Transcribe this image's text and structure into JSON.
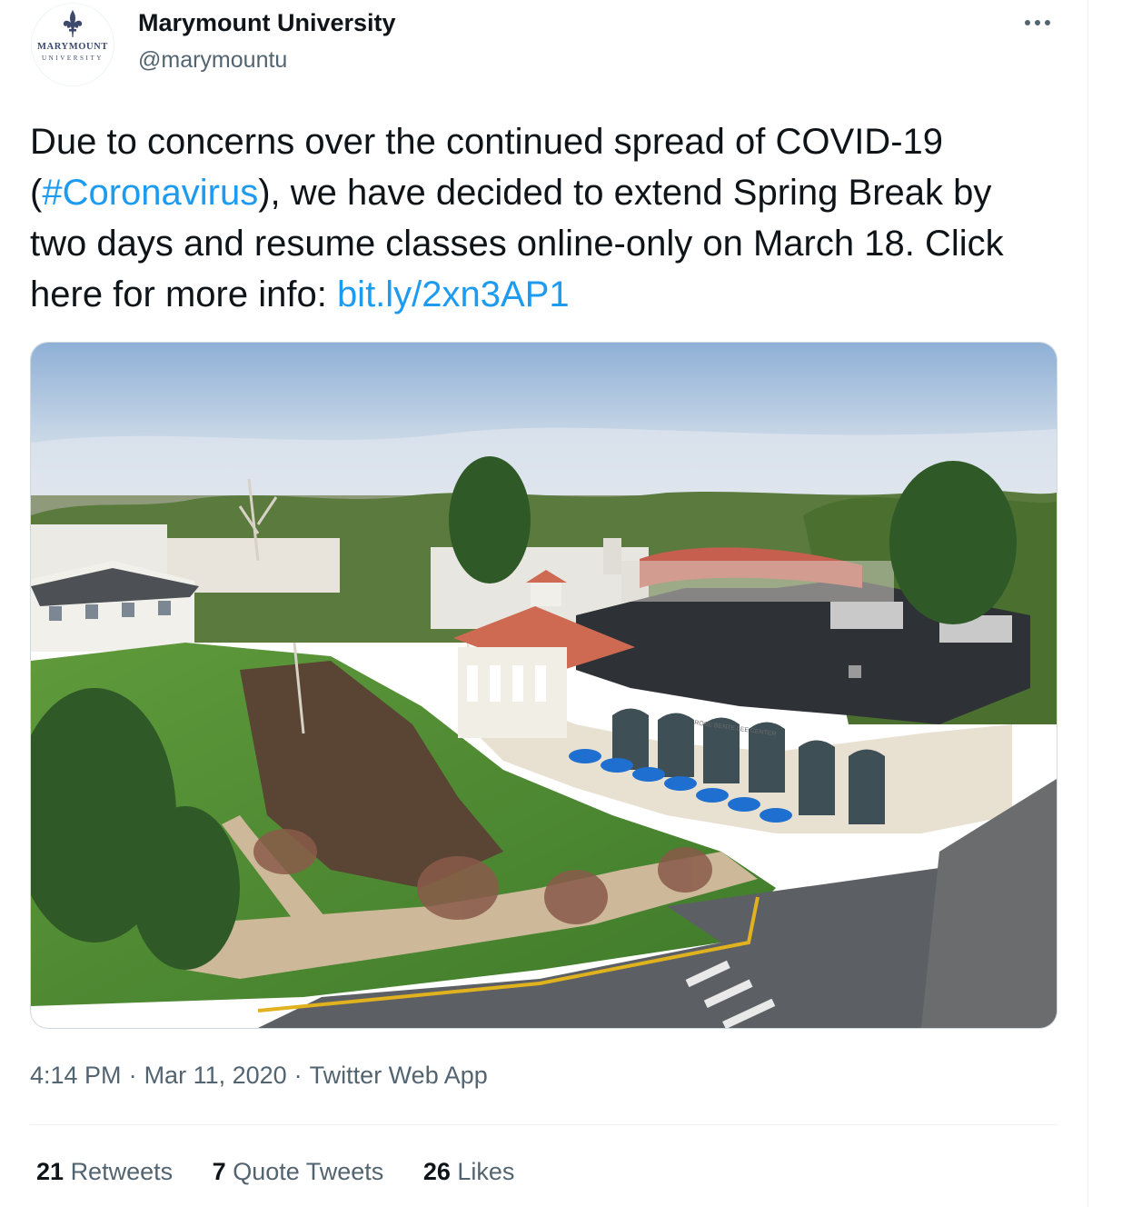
{
  "account": {
    "display_name": "Marymount University",
    "handle": "@marymountu",
    "avatar": {
      "brand": "MARYMOUNT",
      "sub": "UNIVERSITY",
      "icon": "fleur-de-lis-icon",
      "color": "#3d4a6b"
    }
  },
  "menu": {
    "icon": "more-horizontal-icon"
  },
  "tweet": {
    "text_1": "Due to concerns over the continued spread of COVID-19 (",
    "hashtag": "#Coronavirus",
    "text_2": "), we have decided to extend Spring Break by two days and resume classes online-only on March 18. Click here for more info: ",
    "link": "bit.ly/2xn3AP1",
    "link_color": "#1d9bf0"
  },
  "media": {
    "kind": "aerial campus photo",
    "sign_text": "ROSE BENTE LEE CENTER"
  },
  "meta": {
    "time": "4:14 PM",
    "separator": "·",
    "date": "Mar 11, 2020",
    "source": "Twitter Web App"
  },
  "stats": {
    "retweets_count": "21",
    "retweets_label": "Retweets",
    "quotes_count": "7",
    "quotes_label": "Quote Tweets",
    "likes_count": "26",
    "likes_label": "Likes"
  }
}
